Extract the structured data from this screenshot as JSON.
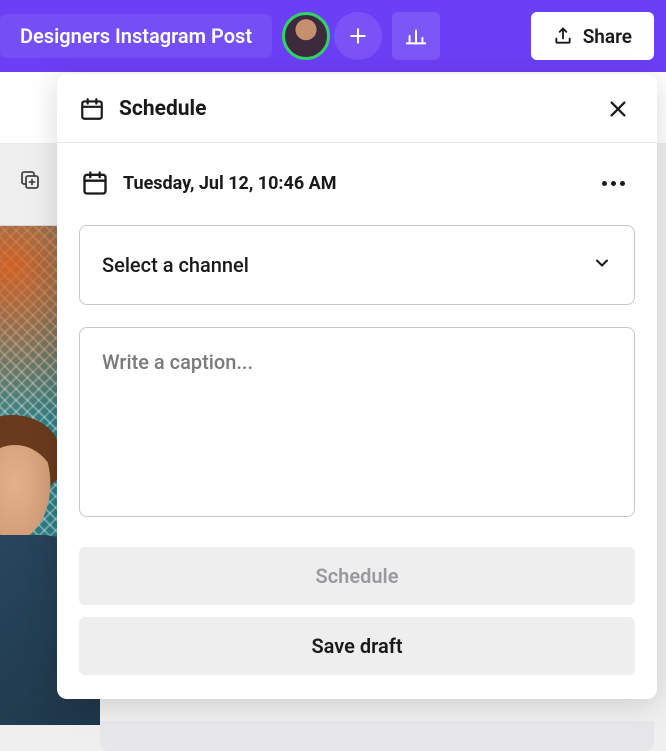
{
  "topbar": {
    "doc_title": "Designers Instagram Post",
    "share_label": "Share"
  },
  "panel": {
    "title": "Schedule",
    "date_text": "Tuesday, Jul 12, 10:46 AM",
    "channel_select_label": "Select a channel",
    "caption_placeholder": "Write a caption...",
    "caption_value": "",
    "schedule_button": "Schedule",
    "save_draft_button": "Save draft"
  }
}
